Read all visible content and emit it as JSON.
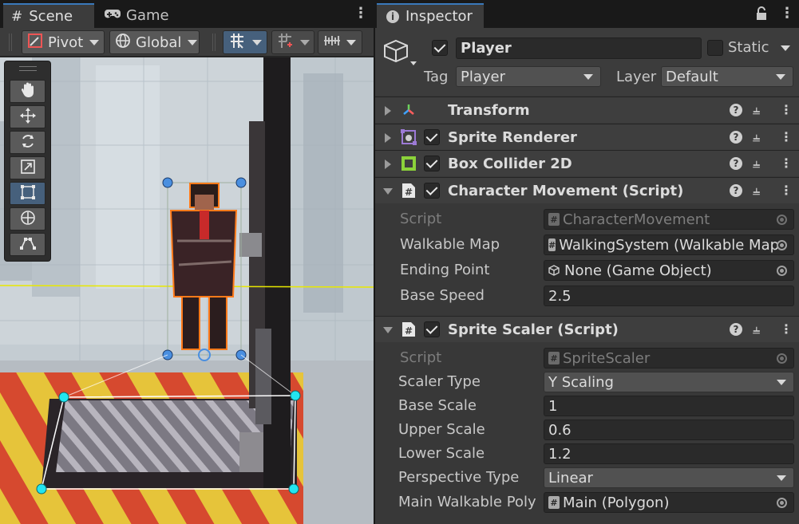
{
  "scene_panel": {
    "tabs": [
      {
        "label": "Scene",
        "icon": "hash-icon"
      },
      {
        "label": "Game",
        "icon": "gamepad-icon"
      }
    ],
    "toolbar": {
      "pivot_label": "Pivot",
      "global_label": "Global"
    },
    "tools": [
      "hand-tool",
      "move-tool",
      "rotate-tool",
      "scale-tool",
      "rect-tool",
      "transform-tool",
      "custom-editor-tool"
    ],
    "active_tool": "rect-tool"
  },
  "inspector": {
    "tab_label": "Inspector",
    "object": {
      "active": true,
      "name": "Player",
      "static_label": "Static",
      "static": false,
      "tag_label": "Tag",
      "tag_value": "Player",
      "layer_label": "Layer",
      "layer_value": "Default"
    },
    "components": [
      {
        "title": "Transform",
        "expanded": false,
        "has_checkbox": false,
        "icon": "transform-axes-icon"
      },
      {
        "title": "Sprite Renderer",
        "expanded": false,
        "has_checkbox": true,
        "enabled": true,
        "icon": "sprite-renderer-icon"
      },
      {
        "title": "Box Collider 2D",
        "expanded": false,
        "has_checkbox": true,
        "enabled": true,
        "icon": "box-collider-icon"
      },
      {
        "title": "Character Movement (Script)",
        "expanded": true,
        "has_checkbox": true,
        "enabled": true,
        "icon": "script-icon"
      },
      {
        "title": "Sprite Scaler (Script)",
        "expanded": true,
        "has_checkbox": true,
        "enabled": true,
        "icon": "script-icon"
      }
    ],
    "character_movement": {
      "script_label": "Script",
      "script_value": "CharacterMovement",
      "walkable_map_label": "Walkable Map",
      "walkable_map_value": "WalkingSystem (Walkable Map",
      "ending_point_label": "Ending Point",
      "ending_point_value": "None (Game Object)",
      "base_speed_label": "Base Speed",
      "base_speed_value": "2.5"
    },
    "sprite_scaler": {
      "script_label": "Script",
      "script_value": "SpriteScaler",
      "scaler_type_label": "Scaler Type",
      "scaler_type_value": "Y Scaling",
      "base_scale_label": "Base Scale",
      "base_scale_value": "1",
      "upper_scale_label": "Upper Scale",
      "upper_scale_value": "0.6",
      "lower_scale_label": "Lower Scale",
      "lower_scale_value": "1.2",
      "perspective_type_label": "Perspective Type",
      "perspective_type_value": "Linear",
      "main_walkable_label": "Main Walkable Poly",
      "main_walkable_value": "Main (Polygon)"
    }
  },
  "colors": {
    "accent_blue": "#3a79bb",
    "handle_blue": "#4a8fe0",
    "collider_cyan": "#23e5f0",
    "selection_orange": "#ff7a1a",
    "guide_yellow": "#e8e800"
  }
}
